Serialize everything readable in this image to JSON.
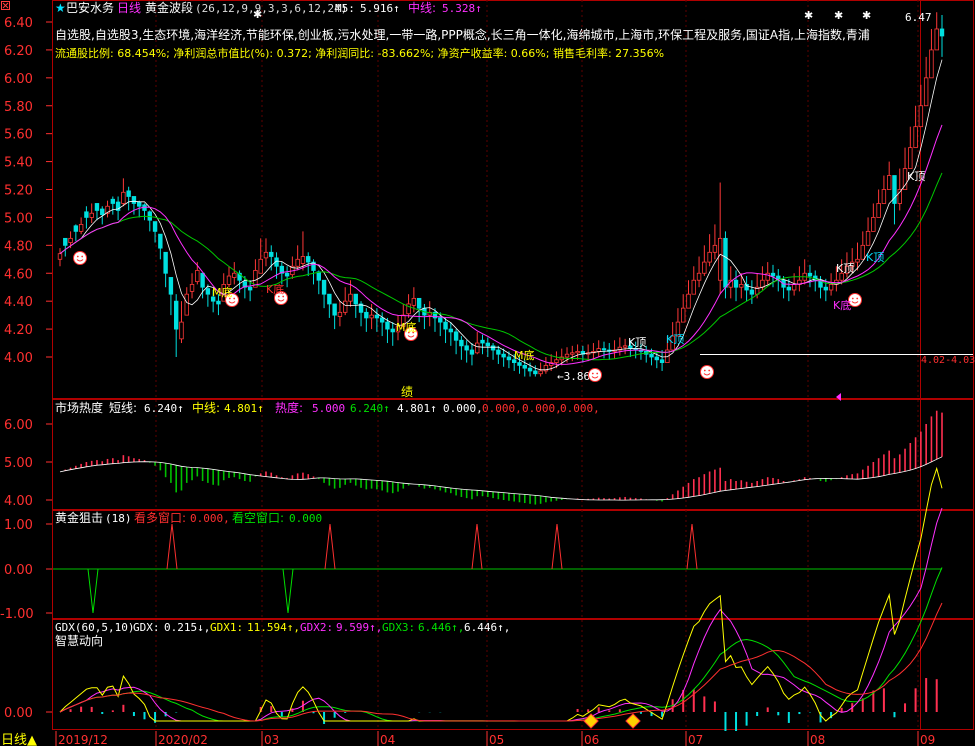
{
  "header": {
    "star": "★",
    "stock_name": "巴安水务",
    "period": "日线",
    "indicator": "黄金波段",
    "params": "(26,12,9,9,3,3,6,12,24)",
    "m5_label": "M5:",
    "m5_value": "5.916↑",
    "mid_label": "中线:",
    "mid_value": "5.328↑"
  },
  "concepts": "自选股,自选股3,生态环境,海洋经济,节能环保,创业板,污水处理,一带一路,PPP概念,长三角一体化,海绵城市,上海市,环保工程及服务,国证A指,上海指数,青浦",
  "finance_line": "流通股比例: 68.454%; 净利润总市值比(%): 0.372; 净利润同比: -83.662%; 净资产收益率: 0.66%; 销售毛利率: 27.356%",
  "colors": {
    "up": "#ff3838",
    "down": "#00e0e0",
    "mid_line": "#ff30ff",
    "slow_line": "#00c800",
    "ma5": "#ffffff",
    "axis": "#b00000",
    "tick": "#ff3030",
    "yellow": "#ffff00"
  },
  "panel1": {
    "y_ticks": [
      "6.40",
      "6.20",
      "6.00",
      "5.80",
      "5.60",
      "5.40",
      "5.20",
      "5.00",
      "4.80",
      "4.60",
      "4.40",
      "4.20",
      "4.00"
    ],
    "annotations": {
      "high": "6.47",
      "low": "3.86",
      "range_label": "4.02-4.03",
      "m_bottom": "M底",
      "k_bottom": "K底",
      "k_top": "K顶",
      "perf": "绩"
    }
  },
  "panel2": {
    "title": "市场热度",
    "short_label": "短线:",
    "short_value": "6.240↑",
    "mid_label": "中线:",
    "mid_value": "4.801↑",
    "heat_label": "热度:",
    "heat_value": "5.000",
    "v1": "6.240↑",
    "v2": "4.801↑",
    "v3": "0.000,",
    "v4": "0.000,",
    "v5": "0.000,",
    "v6": "0.000,",
    "y_ticks": [
      "6.00",
      "5.00",
      "4.00"
    ]
  },
  "panel3": {
    "title": "黄金狙击",
    "param": "(18)",
    "bull_label": "看多窗口:",
    "bull_value": "0.000,",
    "bear_label": "看空窗口:",
    "bear_value": "0.000",
    "y_ticks": [
      "1.00",
      "0.00",
      "-1.00"
    ]
  },
  "panel4": {
    "title": "GDX(60,5,10)",
    "gdx_label": "GDX:",
    "gdx_value": "0.215↓,",
    "gdx1_label": "GDX1:",
    "gdx1_value": "11.594↑,",
    "gdx2_label": "GDX2:",
    "gdx2_value": "9.599↑,",
    "gdx3_label": "GDX3:",
    "gdx3_value": "6.446↑,",
    "extra_value": "6.446↑,",
    "subtitle": "智慧动向",
    "y_ticks": [
      "0.00"
    ]
  },
  "bottom": {
    "period_button": "日线▲",
    "months": [
      "2019/12",
      "2020/02",
      "03",
      "04",
      "05",
      "06",
      "07",
      "08",
      "09"
    ]
  },
  "chart_data": {
    "type": "candlestick",
    "ylim": [
      3.8,
      6.5
    ],
    "closes": [
      4.74,
      4.8,
      4.85,
      4.9,
      4.95,
      5.0,
      5.03,
      5.05,
      5.02,
      5.08,
      5.1,
      5.05,
      5.18,
      5.15,
      5.1,
      5.08,
      5.05,
      4.98,
      4.9,
      4.78,
      4.6,
      4.45,
      4.2,
      4.25,
      4.45,
      4.52,
      4.62,
      4.5,
      4.45,
      4.4,
      4.38,
      4.52,
      4.58,
      4.6,
      4.55,
      4.5,
      4.48,
      4.62,
      4.7,
      4.75,
      4.72,
      4.65,
      4.6,
      4.58,
      4.65,
      4.7,
      4.72,
      4.68,
      4.62,
      4.55,
      4.45,
      4.38,
      4.3,
      4.32,
      4.4,
      4.45,
      4.38,
      4.32,
      4.28,
      4.3,
      4.28,
      4.25,
      4.2,
      4.18,
      4.22,
      4.3,
      4.38,
      4.42,
      4.35,
      4.3,
      4.32,
      4.28,
      4.25,
      4.2,
      4.18,
      4.12,
      4.08,
      4.05,
      4.02,
      4.1,
      4.1,
      4.08,
      4.05,
      4.02,
      4.0,
      3.98,
      3.96,
      3.94,
      3.92,
      3.9,
      3.88,
      3.9,
      3.94,
      3.96,
      3.98,
      4.0,
      4.02,
      4.03,
      4.04,
      4.02,
      4.03,
      4.04,
      4.06,
      4.05,
      4.04,
      4.05,
      4.07,
      4.08,
      4.06,
      4.05,
      4.04,
      4.02,
      4.0,
      3.98,
      3.96,
      4.05,
      4.15,
      4.25,
      4.35,
      4.45,
      4.55,
      4.6,
      4.68,
      4.75,
      4.8,
      4.85,
      4.5,
      4.55,
      4.5,
      4.52,
      4.48,
      4.45,
      4.5,
      4.55,
      4.6,
      4.58,
      4.55,
      4.5,
      4.48,
      4.52,
      4.55,
      4.6,
      4.58,
      4.55,
      4.5,
      4.48,
      4.52,
      4.55,
      4.6,
      4.65,
      4.68,
      4.7,
      4.8,
      4.9,
      5.0,
      5.1,
      5.2,
      5.3,
      5.1,
      5.2,
      5.35,
      5.5,
      5.65,
      5.8,
      6.0,
      6.2,
      6.35,
      6.3
    ],
    "highs": [
      4.78,
      4.85,
      4.9,
      4.95,
      5.0,
      5.08,
      5.1,
      5.1,
      5.08,
      5.12,
      5.15,
      5.15,
      5.28,
      5.22,
      5.15,
      5.12,
      5.1,
      5.05,
      4.95,
      4.85,
      4.7,
      4.55,
      4.45,
      4.4,
      4.5,
      4.6,
      4.68,
      4.58,
      4.52,
      4.48,
      4.45,
      4.6,
      4.65,
      4.68,
      4.62,
      4.58,
      4.55,
      4.7,
      4.85,
      4.85,
      4.8,
      4.75,
      4.68,
      4.65,
      4.72,
      4.8,
      4.9,
      4.75,
      4.7,
      4.62,
      4.52,
      4.45,
      4.38,
      4.4,
      4.5,
      4.55,
      4.45,
      4.4,
      4.35,
      4.38,
      4.35,
      4.32,
      4.28,
      4.25,
      4.3,
      4.38,
      4.45,
      4.5,
      4.42,
      4.38,
      4.4,
      4.35,
      4.32,
      4.28,
      4.25,
      4.2,
      4.15,
      4.12,
      4.1,
      4.18,
      4.16,
      4.14,
      4.1,
      4.08,
      4.06,
      4.04,
      4.02,
      4.0,
      3.98,
      3.96,
      3.94,
      3.96,
      4.0,
      4.02,
      4.04,
      4.06,
      4.07,
      4.08,
      4.09,
      4.08,
      4.09,
      4.1,
      4.12,
      4.11,
      4.1,
      4.12,
      4.14,
      4.13,
      4.12,
      4.11,
      4.1,
      4.08,
      4.06,
      4.04,
      4.05,
      4.15,
      4.25,
      4.35,
      4.45,
      4.55,
      4.65,
      4.72,
      4.8,
      4.88,
      4.95,
      5.25,
      4.9,
      4.65,
      4.62,
      4.6,
      4.58,
      4.55,
      4.6,
      4.65,
      4.68,
      4.66,
      4.63,
      4.58,
      4.56,
      4.6,
      4.65,
      4.7,
      4.66,
      4.62,
      4.58,
      4.56,
      4.6,
      4.65,
      4.7,
      4.75,
      4.78,
      4.82,
      4.9,
      5.0,
      5.1,
      5.2,
      5.3,
      5.4,
      5.3,
      5.35,
      5.5,
      5.65,
      5.8,
      5.95,
      6.15,
      6.35,
      6.47,
      6.45
    ],
    "lows": [
      4.65,
      4.72,
      4.78,
      4.83,
      4.88,
      4.92,
      4.96,
      4.98,
      4.95,
      5.0,
      5.02,
      4.98,
      5.08,
      5.05,
      5.02,
      5.0,
      4.98,
      4.9,
      4.82,
      4.7,
      4.5,
      4.3,
      4.0,
      4.1,
      4.35,
      4.42,
      4.52,
      4.42,
      4.36,
      4.32,
      4.3,
      4.42,
      4.5,
      4.52,
      4.46,
      4.42,
      4.4,
      4.52,
      4.6,
      4.65,
      4.62,
      4.56,
      4.52,
      4.5,
      4.56,
      4.62,
      4.62,
      4.58,
      4.52,
      4.45,
      4.35,
      4.28,
      4.2,
      4.22,
      4.3,
      4.36,
      4.28,
      4.22,
      4.18,
      4.2,
      4.18,
      4.15,
      4.1,
      4.08,
      4.12,
      4.2,
      4.28,
      4.32,
      4.25,
      4.2,
      4.22,
      4.18,
      4.15,
      4.1,
      4.08,
      4.02,
      3.98,
      3.96,
      3.94,
      4.02,
      4.02,
      4.0,
      3.98,
      3.95,
      3.93,
      3.92,
      3.9,
      3.88,
      3.86,
      3.86,
      3.86,
      3.86,
      3.88,
      3.9,
      3.92,
      3.94,
      3.96,
      3.97,
      3.98,
      3.96,
      3.97,
      3.98,
      4.0,
      3.99,
      3.98,
      3.99,
      4.01,
      4.02,
      4.0,
      3.99,
      3.98,
      3.96,
      3.94,
      3.92,
      3.9,
      3.96,
      4.05,
      4.15,
      4.25,
      4.35,
      4.45,
      4.5,
      4.58,
      4.65,
      4.7,
      4.45,
      4.42,
      4.42,
      4.4,
      4.42,
      4.4,
      4.38,
      4.42,
      4.48,
      4.52,
      4.5,
      4.47,
      4.42,
      4.4,
      4.44,
      4.47,
      4.52,
      4.5,
      4.47,
      4.42,
      4.4,
      4.44,
      4.47,
      4.52,
      4.57,
      4.6,
      4.62,
      4.7,
      4.8,
      4.9,
      5.0,
      5.1,
      5.2,
      4.95,
      5.05,
      5.2,
      5.35,
      5.5,
      5.65,
      5.85,
      6.05,
      6.2,
      6.15
    ],
    "opens_offset": [
      -0.04,
      0.05,
      -0.03,
      0.04,
      -0.05,
      0.04,
      -0.03,
      0.05,
      0.04,
      -0.05,
      0.03,
      0.06,
      -0.08,
      0.04,
      0.05,
      0.03,
      0.04,
      0.06,
      0.07,
      0.1,
      0.15,
      0.12,
      0.2,
      -0.12,
      -0.15,
      -0.05,
      -0.08,
      0.1,
      0.04,
      0.03,
      0.02,
      -0.12,
      -0.06,
      -0.03,
      0.05,
      0.04,
      0.02,
      -0.12,
      -0.1,
      -0.04,
      0.03,
      0.06,
      0.05,
      0.02,
      -0.06,
      -0.05,
      -0.05,
      0.04,
      0.06,
      0.06,
      0.1,
      0.07,
      0.08,
      -0.03,
      -0.08,
      -0.05,
      0.07,
      0.06,
      0.04,
      -0.02,
      0.02,
      0.03,
      0.05,
      0.02,
      -0.04,
      -0.08,
      -0.07,
      -0.05,
      0.07,
      0.05,
      -0.02,
      0.04,
      0.03,
      0.05,
      0.02,
      0.06,
      0.04,
      0.03,
      0.03,
      -0.07,
      0.02,
      0.02,
      0.03,
      0.03,
      0.02,
      0.02,
      0.02,
      0.02,
      0.02,
      0.02,
      0.02,
      -0.02,
      -0.04,
      -0.02,
      -0.02,
      -0.02,
      -0.02,
      -0.01,
      -0.01,
      0.02,
      -0.01,
      -0.01,
      -0.02,
      0.01,
      0.01,
      -0.01,
      -0.02,
      -0.01,
      0.02,
      0.01,
      0.01,
      0.02,
      0.02,
      0.02,
      0.02,
      -0.09,
      -0.1,
      -0.1,
      -0.1,
      -0.1,
      -0.1,
      -0.05,
      -0.08,
      -0.07,
      -0.05,
      -0.3,
      0.35,
      -0.05,
      0.05,
      -0.02,
      0.04,
      0.03,
      -0.05,
      -0.05,
      -0.05,
      0.02,
      0.03,
      0.05,
      0.02,
      -0.04,
      -0.03,
      -0.05,
      0.02,
      0.03,
      0.05,
      0.02,
      -0.04,
      -0.03,
      -0.05,
      -0.05,
      -0.03,
      -0.02,
      -0.1,
      -0.1,
      -0.1,
      -0.1,
      -0.1,
      -0.1,
      0.2,
      -0.1,
      -0.15,
      -0.15,
      -0.15,
      -0.15,
      -0.2,
      -0.2,
      -0.15,
      0.05
    ]
  }
}
